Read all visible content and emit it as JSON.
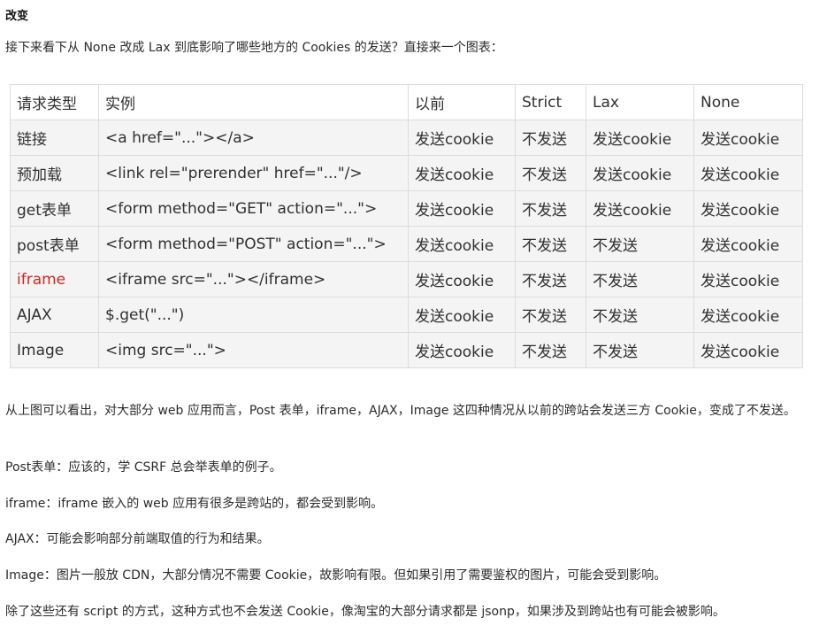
{
  "heading": "改变",
  "intro": "接下来看下从 None 改成 Lax 到底影响了哪些地方的 Cookies 的发送？直接来一个图表：",
  "table": {
    "headers": [
      "请求类型",
      "实例",
      "以前",
      "Strict",
      "Lax",
      "None"
    ],
    "rows": [
      [
        "链接",
        "<a href=\"...\"></a>",
        "发送cookie",
        "不发送",
        "发送cookie",
        "发送cookie"
      ],
      [
        "预加载",
        "<link rel=\"prerender\" href=\"...\"/>",
        "发送cookie",
        "不发送",
        "发送cookie",
        "发送cookie"
      ],
      [
        "get表单",
        "<form method=\"GET\" action=\"...\">",
        "发送cookie",
        "不发送",
        "发送cookie",
        "发送cookie"
      ],
      [
        "post表单",
        "<form method=\"POST\" action=\"...\">",
        "发送cookie",
        "不发送",
        "不发送",
        "发送cookie"
      ],
      [
        "iframe",
        "<iframe src=\"...\"></iframe>",
        "发送cookie",
        "不发送",
        "不发送",
        "发送cookie"
      ],
      [
        "AJAX",
        "$.get(\"...\")",
        "发送cookie",
        "不发送",
        "不发送",
        "发送cookie"
      ],
      [
        "Image",
        "<img src=\"...\">",
        "发送cookie",
        "不发送",
        "不发送",
        "发送cookie"
      ]
    ],
    "highlight_color": "#d0271f"
  },
  "paragraphs": {
    "summary": "从上图可以看出，对大部分 web 应用而言，Post 表单，iframe，AJAX，Image 这四种情况从以前的跨站会发送三方 Cookie，变成了不发送。",
    "post": "Post表单：应该的，学 CSRF 总会举表单的例子。",
    "iframe": "iframe：iframe 嵌入的 web 应用有很多是跨站的，都会受到影响。",
    "ajax": "AJAX：可能会影响部分前端取值的行为和结果。",
    "image": "Image：图片一般放 CDN，大部分情况不需要 Cookie，故影响有限。但如果引用了需要鉴权的图片，可能会受到影响。",
    "script": "除了这些还有 script 的方式，这种方式也不会发送 Cookie，像淘宝的大部分请求都是 jsonp，如果涉及到跨站也有可能会被影响。"
  }
}
